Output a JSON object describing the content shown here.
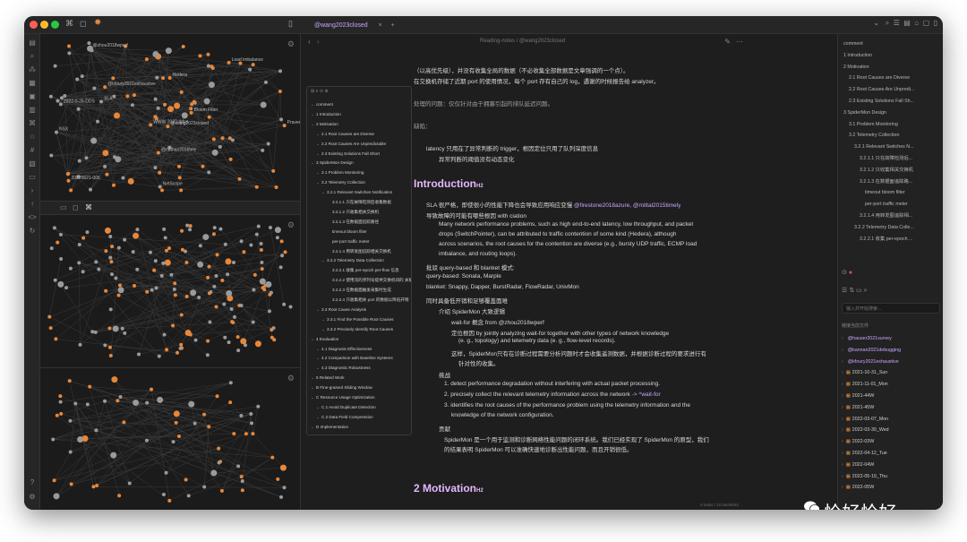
{
  "tab": {
    "title": "@wang2023closed",
    "title_center": "Reading-notes / @wang2023closed"
  },
  "toc": {
    "items": [
      {
        "label": "comment",
        "level": 0
      },
      {
        "label": "1 Introduction",
        "level": 0
      },
      {
        "label": "2 Motivation",
        "level": 0
      },
      {
        "label": "2.1 Root Causes are Diverse",
        "level": 1
      },
      {
        "label": "2.2 Root Causes Are Unpredictable",
        "level": 1
      },
      {
        "label": "2.3 Existing Solutions Fall Short",
        "level": 1
      },
      {
        "label": "3 SpiderMon Design",
        "level": 0
      },
      {
        "label": "3.1 Problem Monitoring",
        "level": 1
      },
      {
        "label": "3.2 Telemetry Collection",
        "level": 1
      },
      {
        "label": "3.2.1 Relevant Switches Notification",
        "level": 2
      },
      {
        "label": "3.2.1.1 只在故障检测后收集数据",
        "level": 3
      },
      {
        "label": "3.2.1.2 只收集相关交换机",
        "level": 3
      },
      {
        "label": "3.2.1.3 在数据面追踪路径",
        "level": 3
      },
      {
        "label": "timeout bloom filter",
        "level": 3
      },
      {
        "label": "per-port traffic meter",
        "level": 3
      },
      {
        "label": "3.2.1.4 用转发图追踪相关交换机",
        "level": 3
      },
      {
        "label": "3.2.2 Telemetry Data Collection",
        "level": 2
      },
      {
        "label": "3.2.2.1 收集 per-epoch per-flow 信息",
        "level": 3
      },
      {
        "label": "3.2.2.2 使用流的序列号提供交换机间的 关联",
        "level": 3
      },
      {
        "label": "3.2.2.3 在数据面触发采集时生成",
        "level": 3
      },
      {
        "label": "3.2.2.4 只收集相关 port 的数据以降低开销",
        "level": 3
      },
      {
        "label": "3.3 Root Cause Analysis",
        "level": 1
      },
      {
        "label": "3.3.1 Find the Possible Root Causes",
        "level": 2
      },
      {
        "label": "3.3.2 Precisely Identify Root Causes",
        "level": 2
      },
      {
        "label": "4 Evaluation",
        "level": 0
      },
      {
        "label": "4.1 Diagnosis Effectiveness",
        "level": 1
      },
      {
        "label": "4.2 Comparison with Baseline Systems",
        "level": 1
      },
      {
        "label": "4.3 Diagnostic Robustness",
        "level": 1
      },
      {
        "label": "5 Related Work",
        "level": 0
      },
      {
        "label": "B Fine-grained Sliding Window",
        "level": 0
      },
      {
        "label": "C Resource Usage Optimization",
        "level": 0
      },
      {
        "label": "C.1 Avoid Duplicate Detection",
        "level": 1
      },
      {
        "label": "C.2 Data Field Compression",
        "level": 1
      },
      {
        "label": "D Implementation",
        "level": 0
      }
    ]
  },
  "doc": {
    "p1": "（以高优先级），并没有收集全局的数据（不必收集全部数据是文章强调的一个点）。",
    "p2": "在交换机存储了近期 port 的使用情况，每个 port 存有自己的 log，遇谢的时候报告给 analyzer。",
    "p3": "处理的问题：仅仅针对由于拥塞引起的排队延迟问题。",
    "p4": "缺陷：",
    "p5": "latency 只用在了异常判断的 trigger，根因定位只用了队列深度信息",
    "p6": "异常判断的阈值没有动态变化",
    "intro_title": "Introduction",
    "b1": "SLA 很严格，即使很小的性能下降也会导致应用响应变慢",
    "b1_links": "@firestone2018azure, @mittal2015timely",
    "b2": "导致故障的可能有哪些根因 with ciation",
    "b3a": "Many network performance problems, such as high end-to-end latency, low throughput, and packet",
    "b3b": "drops (SwitchPointer), can be attributed to traffic contention of some kind (Hedera), although",
    "b3c": "across scenarios, the root causes for the contention are diverse (e.g., bursty UDP traffic, ECMP load",
    "b3d": "imbalance, and routing loops).",
    "b4": "批驳 query-based 和 blanket 模式:",
    "b5": "query-based: Sonata, Marple",
    "b6": "blanket: Snappy, Dapper, BurstRadar, FlowRadar, UnivMon",
    "b7": "同时具备低开销和足够覆盖面难",
    "b8": "介绍 SpiderMon 大致逻辑",
    "b9": "wait-for 概念 from @zhou2018wperf",
    "b10a": "定位根因 by jointly analyzing wait-for together with other types of network knowledge",
    "b10b": "(e. g., topology) and telemetry data (e. g., flow-level records).",
    "b11a": "这样，SpiderMon只有在诊断过程需要分析问题时才会收集遥测数据，并根据诊断过程的要求进行有",
    "b11b": "针对性的收集。",
    "b12": "挑战",
    "b13": "1. detect performance degradation without interfering with actual packet processing.",
    "b14": "2. precisely collect the relevant telemetry information across the network",
    "b14b": "-> ^wait-for",
    "b15a": "3. identifies the root causes of the performance problem using the telemetry information and the",
    "b15b": "knowledge of the network configuration.",
    "b16": "贡献",
    "b17a": "SpiderMon 是一个用于监测和诊断网络性能问题的闭环系统。我们已经实现了 SpiderMon 的原型，我们",
    "b17b": "的结果表明 SpiderMon 可以准确快速地诊断出性能问题，而且开销很低。",
    "motivation_title": "2 Motivation"
  },
  "outline": {
    "items": [
      {
        "label": "comment",
        "level": 0
      },
      {
        "label": "1 Introduction",
        "level": 0
      },
      {
        "label": "2 Motivation",
        "level": 0
      },
      {
        "label": "2.1 Root Causes are Diverse",
        "level": 1
      },
      {
        "label": "2.2 Root Causes Are Unpredi...",
        "level": 1
      },
      {
        "label": "2.3 Existing Solutions Fall Sh...",
        "level": 1
      },
      {
        "label": "3 SpiderMon Design",
        "level": 0
      },
      {
        "label": "3.1 Problem Monitoring",
        "level": 1
      },
      {
        "label": "3.2 Telemetry Collection",
        "level": 1
      },
      {
        "label": "3.2.1 Relevant Switches N...",
        "level": 2
      },
      {
        "label": "3.2.1.1 只在故障检测后...",
        "level": 3
      },
      {
        "label": "3.2.1.2 只收集相关交换机",
        "level": 3
      },
      {
        "label": "3.2.1.3 在数据面追踪路...",
        "level": 3
      },
      {
        "label": "timeout bloom filter",
        "level": 4
      },
      {
        "label": "per-port traffic meter",
        "level": 4
      },
      {
        "label": "3.2.1.4 用转发图追踪相...",
        "level": 3
      },
      {
        "label": "3.2.2 Telemetry Data Colle...",
        "level": 2
      },
      {
        "label": "3.2.2.1 收集 per-epoch ...",
        "level": 3
      }
    ],
    "search_placeholder": "输入并开始搜索..."
  },
  "files": {
    "header": "链接当前文件",
    "items": [
      "@hauser2021survey",
      "@kannan2021debugging",
      "@kfoury2021exhaustive",
      "2021-10-31_Sun",
      "2021-11-01_Mon",
      "2021-44W",
      "2021-45W",
      "2022-03-07_Mon",
      "2022-03-30_Wed",
      "2022-03W",
      "2022-04-12_Tue",
      "2022-04W",
      "2022-05-19_Thu",
      "2022-05W"
    ]
  },
  "graph_labels": [
    "@wang2023closed",
    "Hedera",
    "WWW 2020-ddos",
    "20220621-006",
    "2022-0-26-DDS",
    "Load imbalance",
    "SLA",
    "Bloom Filter",
    "@zhou2018wperf",
    "@kfoury2021exhaustive",
    "@nathan2016tele",
    "NSX",
    "NetScope",
    "Praveen Tammana"
  ],
  "statusbar": "6 tasks / 10 backlinks",
  "watermark": "恰好恰好",
  "colors": {
    "accent": "#c9a6ff",
    "node_orange": "#e8873a",
    "node_gray": "#9a9a9a"
  }
}
